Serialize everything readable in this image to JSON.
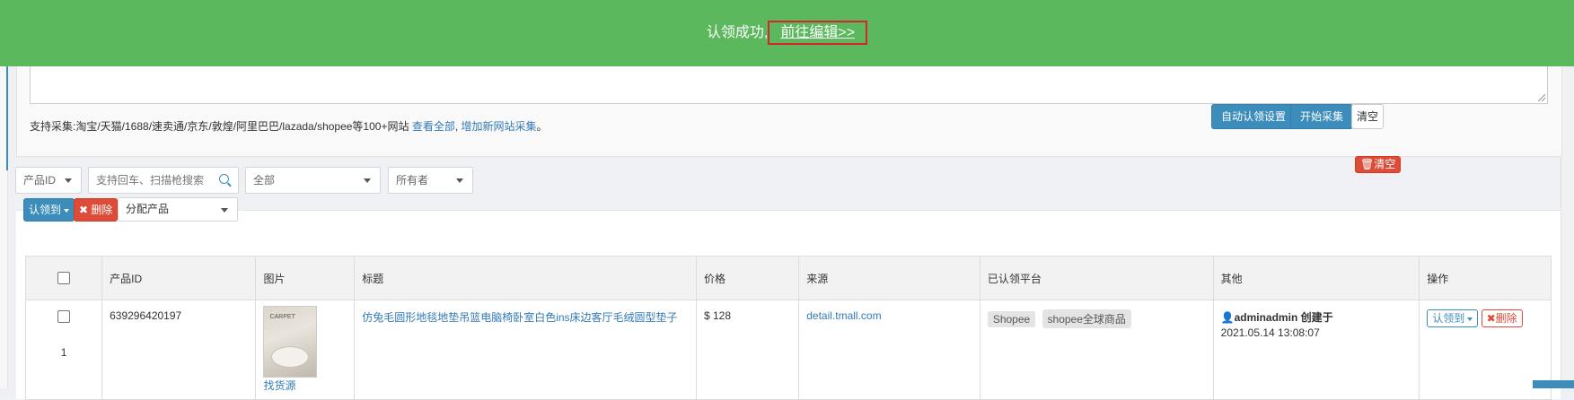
{
  "banner": {
    "message": "认领成功,",
    "edit_link": "前往编辑>>"
  },
  "collector": {
    "support_prefix": "支持采集:淘宝/天猫/1688/速卖通/京东/敦煌/阿里巴巴/lazada/shopee等100+网站",
    "view_all": "查看全部",
    "add_site": "增加新网站采集",
    "suffix": "。",
    "auto_claim_button": "自动认领设置",
    "start_button": "开始采集",
    "clear_button": "清空"
  },
  "filters": {
    "field_select": "产品ID",
    "search_placeholder": "支持回车、扫描枪搜索",
    "status_select": "全部",
    "owner_select": "所有者",
    "clear_button": "清空"
  },
  "toolbar": {
    "claim_button": "认领到",
    "delete_button": "删除",
    "assign_select": "分配产品"
  },
  "table": {
    "headers": [
      "",
      "产品ID",
      "图片",
      "标题",
      "价格",
      "来源",
      "已认领平台",
      "其他",
      "操作"
    ],
    "rows": [
      {
        "index": "1",
        "product_id": "639296420197",
        "image_brand": "CARPET",
        "image_link": "找货源",
        "title": "仿兔毛圆形地毯地垫吊篮电脑椅卧室白色ins床边客厅毛绒圆型垫子",
        "price": "$ 128",
        "source": "detail.tmall.com",
        "platforms": [
          "Shopee",
          "shopee全球商品"
        ],
        "creator": "adminadmin",
        "created_label": "创建于",
        "created_time": "2021.05.14 13:08:07",
        "claim_action": "认领到",
        "delete_action": "删除"
      }
    ]
  },
  "colors": {
    "banner": "#5cb85c",
    "primary": "#3c8dbc",
    "danger": "#dd4b39",
    "highlight_box": "#d9232d"
  }
}
